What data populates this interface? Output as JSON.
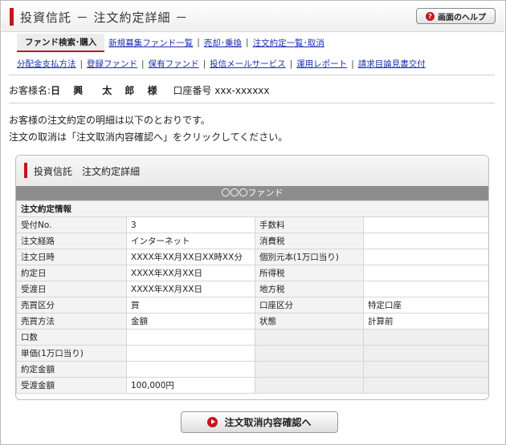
{
  "header": {
    "title": "投資信託 － 注文約定詳細 －",
    "help_label": "画面のヘルプ",
    "help_icon": "?"
  },
  "nav": {
    "primary_active": "ファンド検索･購入",
    "primary_links": [
      "新規募集ファンド一覧",
      "売却･乗換",
      "注文約定一覧･取消"
    ],
    "secondary_links": [
      "分配金支払方法",
      "登録ファンド",
      "保有ファンド",
      "投信メールサービス",
      "運用レポート",
      "請求目論見書交付"
    ],
    "separator": "|"
  },
  "customer": {
    "name_label": "お客様名:",
    "name": "日 興　太 郎 様",
    "account_label": "口座番号",
    "account_number": "xxx-xxxxxx"
  },
  "message": {
    "line1": "お客様の注文約定の明細は以下のとおりです。",
    "line2": "注文の取消は「注文取消内容確認へ」をクリックしてください。"
  },
  "panel": {
    "title": "投資信託　注文約定詳細",
    "fund_name": "〇〇〇ファンド",
    "section_label": "注文約定情報",
    "rows": [
      {
        "l1": "受付No.",
        "v1": "3",
        "l2": "手数料",
        "v2": ""
      },
      {
        "l1": "注文経路",
        "v1": "インターネット",
        "l2": "消費税",
        "v2": ""
      },
      {
        "l1": "注文日時",
        "v1": "XXXX年XX月XX日XX時XX分",
        "l2": "個別元本(1万口当り)",
        "v2": ""
      },
      {
        "l1": "約定日",
        "v1": "XXXX年XX月XX日",
        "l2": "所得税",
        "v2": ""
      },
      {
        "l1": "受渡日",
        "v1": "XXXX年XX月XX日",
        "l2": "地方税",
        "v2": ""
      },
      {
        "l1": "売買区分",
        "v1": "買",
        "l2": "口座区分",
        "v2": "特定口座"
      },
      {
        "l1": "売買方法",
        "v1": "金額",
        "l2": "状態",
        "v2": "計算前"
      },
      {
        "l1": "口数",
        "v1": "",
        "l2": "",
        "v2": ""
      },
      {
        "l1": "単価(1万口当り)",
        "v1": "",
        "l2": "",
        "v2": ""
      },
      {
        "l1": "約定金額",
        "v1": "",
        "l2": "",
        "v2": ""
      },
      {
        "l1": "受渡金額",
        "v1": "100,000円",
        "l2": "",
        "v2": ""
      }
    ]
  },
  "confirm_button": {
    "label": "注文取消内容確認へ"
  },
  "colors": {
    "accent": "#c4161c",
    "link": "#1a2fb0",
    "fund_bar": "#8d8d8d"
  }
}
